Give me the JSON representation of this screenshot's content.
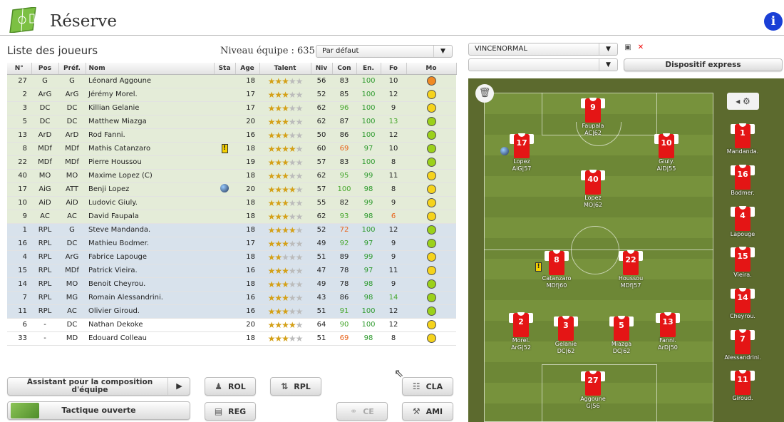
{
  "header": {
    "title": "Réserve",
    "info": "i"
  },
  "list": {
    "title": "Liste des joueurs",
    "team_level": "Niveau équipe : 635",
    "sort_select": "Par défaut",
    "columns": [
      "N°",
      "Pos",
      "Préf.",
      "Nom",
      "Sta",
      "Age",
      "Talent",
      "Niv",
      "Con",
      "En.",
      "Fo",
      "Mo"
    ],
    "rows": [
      {
        "n": "27",
        "pos": "G",
        "pref": "G",
        "name": "Léonard Aggoune",
        "sta": "",
        "age": "18",
        "stars": 3,
        "niv": "56",
        "con": "83",
        "en": "100",
        "fo": "10",
        "mo": "#f08a24",
        "group": "g",
        "con_c": "",
        "en_c": "green",
        "fo_c": ""
      },
      {
        "n": "2",
        "pos": "ArG",
        "pref": "ArG",
        "name": "Jérémy Morel.",
        "sta": "",
        "age": "17",
        "stars": 3,
        "niv": "52",
        "con": "85",
        "en": "100",
        "fo": "12",
        "mo": "#f5d31c",
        "group": "g",
        "con_c": "",
        "en_c": "green",
        "fo_c": ""
      },
      {
        "n": "3",
        "pos": "DC",
        "pref": "DC",
        "name": "Killian Gelanie",
        "sta": "",
        "age": "17",
        "stars": 3,
        "niv": "62",
        "con": "96",
        "en": "100",
        "fo": "9",
        "mo": "#f5d31c",
        "group": "g",
        "con_c": "lgreen",
        "en_c": "green",
        "fo_c": ""
      },
      {
        "n": "5",
        "pos": "DC",
        "pref": "DC",
        "name": "Matthew Miazga",
        "sta": "",
        "age": "20",
        "stars": 3,
        "niv": "62",
        "con": "87",
        "en": "100",
        "fo": "13",
        "mo": "#9bd11a",
        "group": "g",
        "con_c": "",
        "en_c": "green",
        "fo_c": "lgreen"
      },
      {
        "n": "13",
        "pos": "ArD",
        "pref": "ArD",
        "name": "Rod Fanni.",
        "sta": "",
        "age": "16",
        "stars": 3,
        "niv": "50",
        "con": "86",
        "en": "100",
        "fo": "12",
        "mo": "#9bd11a",
        "group": "g",
        "con_c": "",
        "en_c": "green",
        "fo_c": ""
      },
      {
        "n": "8",
        "pos": "MDf",
        "pref": "MDf",
        "name": "Mathis Catanzaro",
        "sta": "card",
        "age": "18",
        "stars": 4,
        "niv": "60",
        "con": "69",
        "en": "97",
        "fo": "10",
        "mo": "#9bd11a",
        "group": "g",
        "con_c": "orange",
        "en_c": "green",
        "fo_c": ""
      },
      {
        "n": "22",
        "pos": "MDf",
        "pref": "MDf",
        "name": "Pierre Houssou",
        "sta": "",
        "age": "19",
        "stars": 3,
        "niv": "57",
        "con": "83",
        "en": "100",
        "fo": "8",
        "mo": "#9bd11a",
        "group": "g",
        "con_c": "",
        "en_c": "green",
        "fo_c": ""
      },
      {
        "n": "40",
        "pos": "MO",
        "pref": "MO",
        "name": "Maxime Lopez (C)",
        "sta": "",
        "age": "18",
        "stars": 3,
        "niv": "62",
        "con": "95",
        "en": "99",
        "fo": "11",
        "mo": "#f5d31c",
        "group": "g",
        "con_c": "lgreen",
        "en_c": "green",
        "fo_c": ""
      },
      {
        "n": "17",
        "pos": "AiG",
        "pref": "ATT",
        "name": "Benji Lopez",
        "sta": "globe",
        "age": "20",
        "stars": 4,
        "niv": "57",
        "con": "100",
        "en": "98",
        "fo": "8",
        "mo": "#f5d31c",
        "group": "g",
        "con_c": "lgreen",
        "en_c": "green",
        "fo_c": ""
      },
      {
        "n": "10",
        "pos": "AiD",
        "pref": "AiD",
        "name": "Ludovic Giuly.",
        "sta": "",
        "age": "18",
        "stars": 3,
        "niv": "55",
        "con": "82",
        "en": "99",
        "fo": "9",
        "mo": "#f5d31c",
        "group": "g",
        "con_c": "",
        "en_c": "green",
        "fo_c": ""
      },
      {
        "n": "9",
        "pos": "AC",
        "pref": "AC",
        "name": "David Faupala",
        "sta": "",
        "age": "18",
        "stars": 3,
        "niv": "62",
        "con": "93",
        "en": "98",
        "fo": "6",
        "mo": "#f5d31c",
        "group": "g",
        "con_c": "lgreen",
        "en_c": "green",
        "fo_c": "orange"
      },
      {
        "n": "1",
        "pos": "RPL",
        "pref": "G",
        "name": "Steve Mandanda.",
        "sta": "",
        "age": "18",
        "stars": 4,
        "niv": "52",
        "con": "72",
        "en": "100",
        "fo": "12",
        "mo": "#9bd11a",
        "group": "b",
        "con_c": "orange",
        "en_c": "green",
        "fo_c": ""
      },
      {
        "n": "16",
        "pos": "RPL",
        "pref": "DC",
        "name": "Mathieu Bodmer.",
        "sta": "",
        "age": "17",
        "stars": 3,
        "niv": "49",
        "con": "92",
        "en": "97",
        "fo": "9",
        "mo": "#9bd11a",
        "group": "b",
        "con_c": "lgreen",
        "en_c": "green",
        "fo_c": ""
      },
      {
        "n": "4",
        "pos": "RPL",
        "pref": "ArG",
        "name": "Fabrice Lapouge",
        "sta": "",
        "age": "18",
        "stars": 2,
        "niv": "51",
        "con": "89",
        "en": "99",
        "fo": "9",
        "mo": "#f5d31c",
        "group": "b",
        "con_c": "",
        "en_c": "green",
        "fo_c": ""
      },
      {
        "n": "15",
        "pos": "RPL",
        "pref": "MDf",
        "name": "Patrick Vieira.",
        "sta": "",
        "age": "16",
        "stars": 3,
        "niv": "47",
        "con": "78",
        "en": "97",
        "fo": "11",
        "mo": "#f5d31c",
        "group": "b",
        "con_c": "",
        "en_c": "green",
        "fo_c": ""
      },
      {
        "n": "14",
        "pos": "RPL",
        "pref": "MO",
        "name": "Benoit Cheyrou.",
        "sta": "",
        "age": "18",
        "stars": 3,
        "niv": "49",
        "con": "78",
        "en": "98",
        "fo": "9",
        "mo": "#9bd11a",
        "group": "b",
        "con_c": "",
        "en_c": "green",
        "fo_c": ""
      },
      {
        "n": "7",
        "pos": "RPL",
        "pref": "MG",
        "name": "Romain Alessandrini.",
        "sta": "",
        "age": "16",
        "stars": 3,
        "niv": "43",
        "con": "86",
        "en": "98",
        "fo": "14",
        "mo": "#9bd11a",
        "group": "b",
        "con_c": "",
        "en_c": "green",
        "fo_c": "lgreen"
      },
      {
        "n": "11",
        "pos": "RPL",
        "pref": "AC",
        "name": "Olivier Giroud.",
        "sta": "",
        "age": "16",
        "stars": 3,
        "niv": "51",
        "con": "91",
        "en": "100",
        "fo": "12",
        "mo": "#9bd11a",
        "group": "b",
        "con_c": "lgreen",
        "en_c": "green",
        "fo_c": ""
      },
      {
        "n": "6",
        "pos": "-",
        "pref": "DC",
        "name": "Nathan Dekoke",
        "sta": "",
        "age": "20",
        "stars": 4,
        "niv": "64",
        "con": "90",
        "en": "100",
        "fo": "12",
        "mo": "#f5d31c",
        "group": "w",
        "con_c": "lgreen",
        "en_c": "green",
        "fo_c": ""
      },
      {
        "n": "33",
        "pos": "-",
        "pref": "MD",
        "name": "Edouard Colleau",
        "sta": "",
        "age": "18",
        "stars": 3,
        "niv": "51",
        "con": "69",
        "en": "98",
        "fo": "8",
        "mo": "#f5d31c",
        "group": "w",
        "con_c": "orange",
        "en_c": "green",
        "fo_c": ""
      }
    ]
  },
  "buttons": {
    "assistant": "Assistant pour la composition d'équipe",
    "tactique": "Tactique ouverte",
    "rol": "ROL",
    "reg": "REG",
    "rpl": "RPL",
    "ce": "CE",
    "cla": "CLA",
    "ami": "AMI",
    "dispositif": "Dispositif express"
  },
  "selects": {
    "formation": "VINCENORMAL",
    "second": ""
  },
  "pitch": {
    "players": [
      {
        "num": "9",
        "label": "Faupala",
        "sub": "AC|62",
        "mark": ""
      },
      {
        "num": "17",
        "label": "Lopez",
        "sub": "AiG|57",
        "mark": "globe"
      },
      {
        "num": "10",
        "label": "Giuly.",
        "sub": "AiD|55",
        "mark": ""
      },
      {
        "num": "40",
        "label": "Lopez",
        "sub": "MO|62",
        "mark": ""
      },
      {
        "num": "8",
        "label": "Catanzaro",
        "sub": "MDf|60",
        "mark": "card"
      },
      {
        "num": "22",
        "label": "Houssou",
        "sub": "MDf|57",
        "mark": ""
      },
      {
        "num": "2",
        "label": "Morel.",
        "sub": "ArG|52",
        "mark": ""
      },
      {
        "num": "3",
        "label": "Gelanie",
        "sub": "DC|62",
        "mark": ""
      },
      {
        "num": "5",
        "label": "Miazga",
        "sub": "DC|62",
        "mark": ""
      },
      {
        "num": "13",
        "label": "Fanni.",
        "sub": "ArD|50",
        "mark": ""
      },
      {
        "num": "27",
        "label": "Aggoune",
        "sub": "G|56",
        "mark": ""
      }
    ],
    "bench": [
      {
        "num": "1",
        "label": "Mandanda."
      },
      {
        "num": "16",
        "label": "Bodmer."
      },
      {
        "num": "4",
        "label": "Lapouge"
      },
      {
        "num": "15",
        "label": "Vieira."
      },
      {
        "num": "14",
        "label": "Cheyrou."
      },
      {
        "num": "7",
        "label": "Alessandrini."
      },
      {
        "num": "11",
        "label": "Giroud."
      }
    ]
  }
}
